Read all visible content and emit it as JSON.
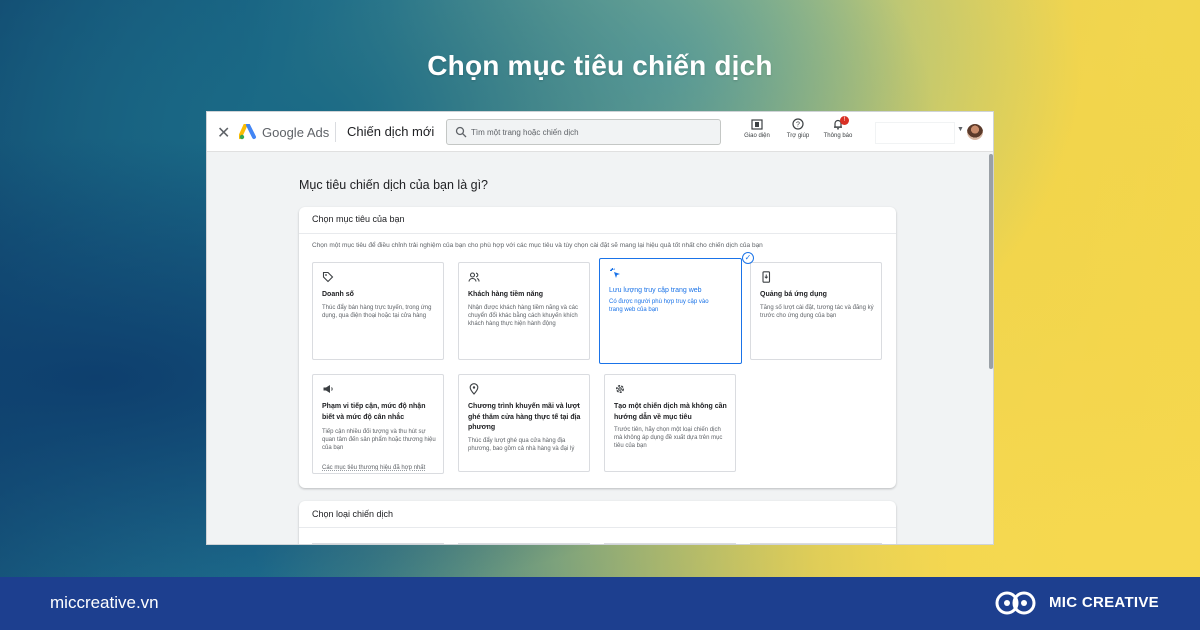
{
  "headline": "Chọn mục tiêu chiến dịch",
  "app": {
    "close_glyph": "✕",
    "product_name": "Google Ads",
    "page_title": "Chiến dịch mới",
    "search_placeholder": "Tìm một trang hoặc chiến dịch",
    "tools": [
      {
        "label": "Giao diện",
        "icon": "appearance-icon"
      },
      {
        "label": "Trợ giúp",
        "icon": "help-icon"
      },
      {
        "label": "Thông báo",
        "icon": "bell-icon",
        "badge": "!"
      }
    ]
  },
  "main": {
    "question": "Mục tiêu chiến dịch của bạn là gì?",
    "goal_card": {
      "title": "Chọn mục tiêu của bạn",
      "description": "Chọn một mục tiêu để điều chỉnh trải nghiệm của bạn cho phù hợp với các mục tiêu và tùy chọn cài đặt sẽ mang lại hiệu quả tốt nhất cho chiến dịch của bạn",
      "goals": [
        {
          "title": "Doanh số",
          "text": "Thúc đẩy bán hàng trực tuyến, trong ứng dụng, qua điện thoại hoặc tại cửa hàng",
          "icon": "tag-icon"
        },
        {
          "title": "Khách hàng tiềm năng",
          "text": "Nhận được khách hàng tiềm năng và các chuyển đổi khác bằng cách khuyến khích khách hàng thực hiện hành động",
          "icon": "people-icon"
        },
        {
          "title": "Lưu lượng truy cập trang web",
          "text": "Có được người phù hợp truy cập vào trang web của bạn",
          "icon": "cursor-click-icon",
          "selected": true
        },
        {
          "title": "Quảng bá ứng dụng",
          "text": "Tăng số lượt cài đặt, tương tác và đăng ký trước cho ứng dụng của bạn",
          "icon": "phone-download-icon"
        },
        {
          "title": "Phạm vi tiếp cận, mức độ nhận biết và mức độ cân nhắc",
          "text": "Tiếp cận nhiều đối tượng và thu hút sự quan tâm đến sản phẩm hoặc thương hiệu của bạn",
          "icon": "megaphone-icon",
          "link": "Các mục tiêu thương hiệu đã hợp nhất"
        },
        {
          "title": "Chương trình khuyến mãi và lượt ghé thăm cửa hàng thực tế tại địa phương",
          "text": "Thúc đẩy lượt ghé qua cửa hàng địa phương, bao gồm cả nhà hàng và đại lý",
          "icon": "location-pin-icon"
        },
        {
          "title": "Tạo một chiến dịch mà không cần hướng dẫn về mục tiêu",
          "text": "Trước tiên, hãy chọn một loại chiến dịch mà không áp dụng đề xuất dựa trên mục tiêu của bạn",
          "icon": "gear-icon"
        }
      ]
    },
    "type_card": {
      "title": "Chọn loại chiến dịch"
    }
  },
  "footer": {
    "site": "miccreative.vn",
    "brand": "MIC CREATIVE"
  },
  "colors": {
    "accent": "#1a73e8",
    "footer_bg": "#1d3f8f",
    "badge": "#d93025"
  }
}
